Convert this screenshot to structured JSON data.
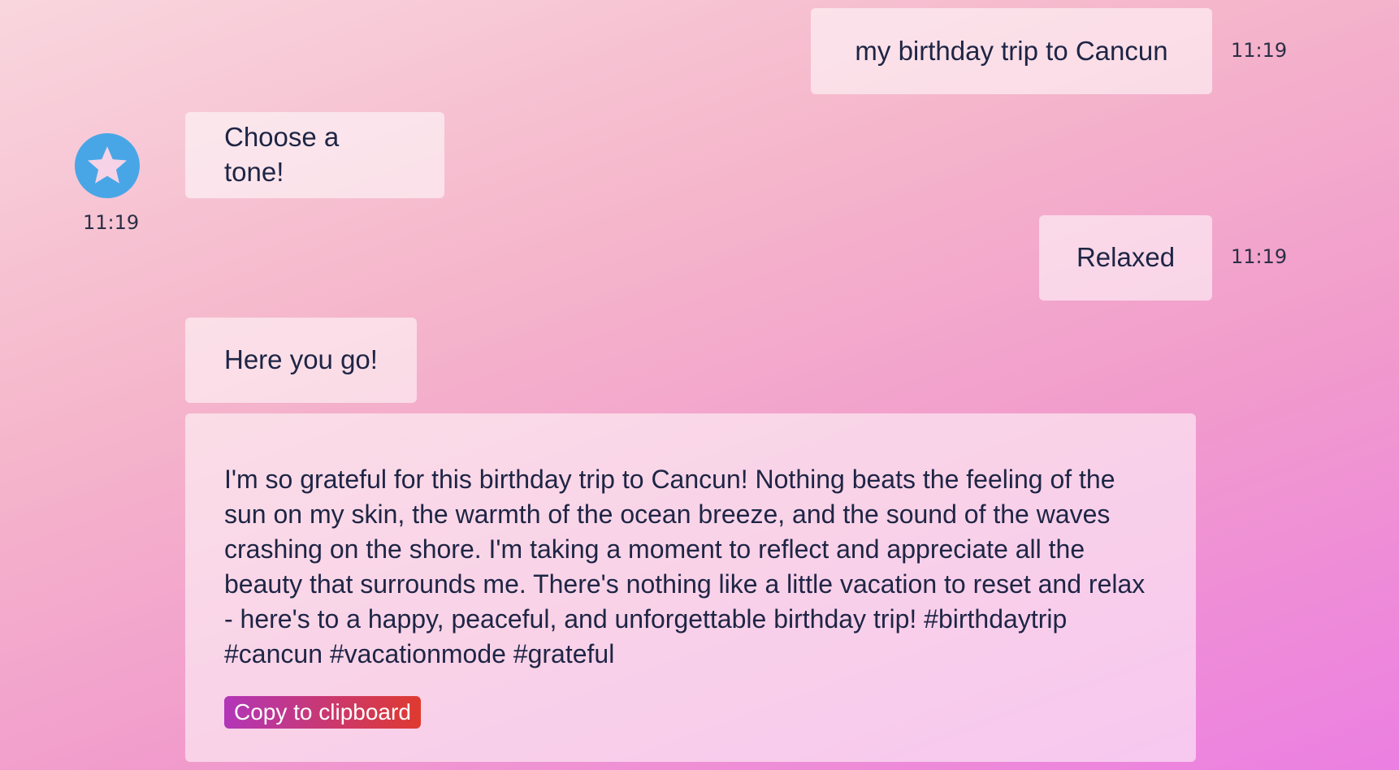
{
  "messages": [
    {
      "sender": "user",
      "text": "my birthday trip to Cancun",
      "time": "11:19"
    },
    {
      "sender": "bot",
      "text": "Choose a tone!",
      "time": "11:19"
    },
    {
      "sender": "user",
      "text": "Relaxed",
      "time": "11:19"
    },
    {
      "sender": "bot",
      "text": "Here you go!"
    }
  ],
  "result": {
    "text": "I'm so grateful for this birthday trip to Cancun! Nothing beats the feeling of the sun on my skin, the warmth of the ocean breeze, and the sound of the waves crashing on the shore. I'm taking a moment to reflect and appreciate all the beauty that surrounds me. There's nothing like a little vacation to reset and relax - here's to a happy, peaceful, and unforgettable birthday trip! #birthdaytrip #cancun #vacationmode #grateful",
    "copy_label": "Copy to clipboard"
  },
  "avatar": {
    "icon": "star-icon",
    "color": "#48a6e6"
  },
  "colors": {
    "text": "#1e2545",
    "copy_gradient_start": "#b236b8",
    "copy_gradient_end": "#df3a2f"
  }
}
